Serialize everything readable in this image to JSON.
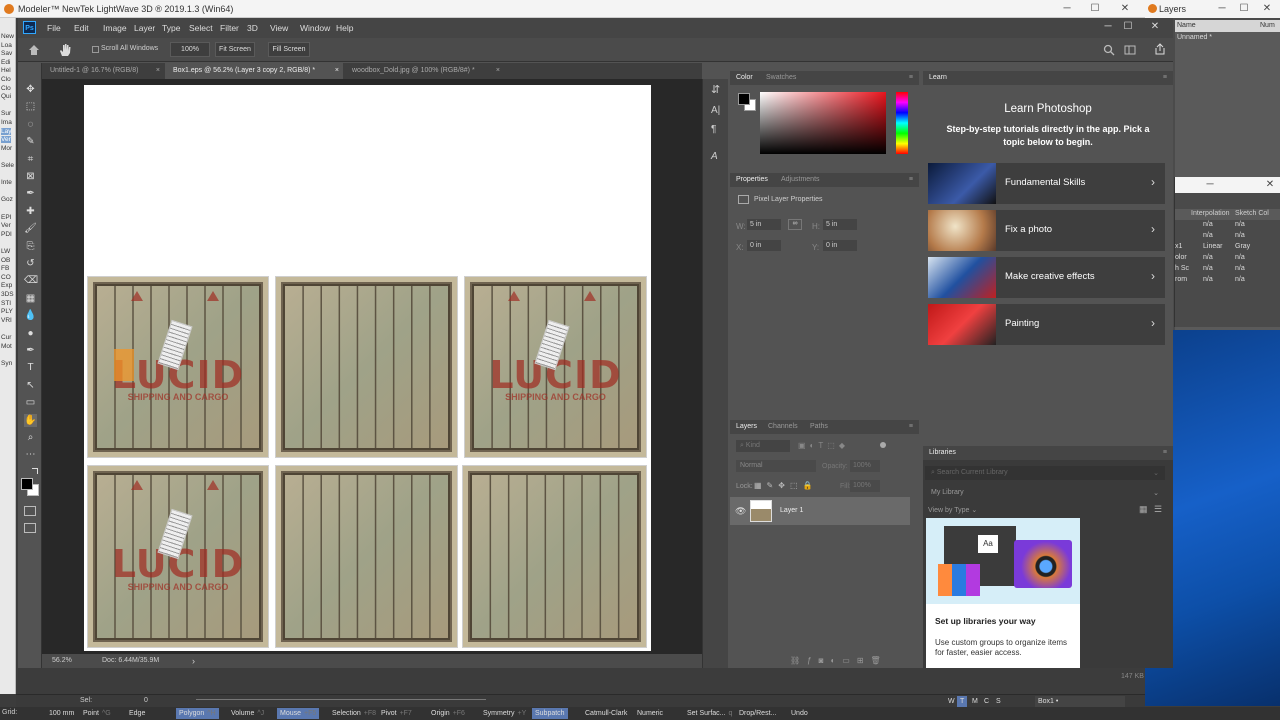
{
  "modeler": {
    "title": "Modeler™ NewTek LightWave 3D ® 2019.1.3 (Win64)",
    "left_items": [
      "New",
      "Loa",
      "Sav",
      "Edi",
      "Hel",
      "Clo",
      "Clo",
      "Qui",
      "",
      "Sur",
      "Ima",
      "Lay",
      "Ver",
      "Mor",
      "",
      "Sele",
      "",
      "Inte",
      "",
      "Goz",
      "",
      "EPI",
      "Ver",
      "PDI",
      "",
      "LW",
      "OB",
      "FB",
      "CO",
      "Exp",
      "3DS",
      "STI",
      "PLY",
      "VRI",
      "",
      "Cur",
      "Mot",
      "",
      "Syn"
    ],
    "bottom1": {
      "sel_label": "Sel:",
      "sel_value": "0"
    },
    "bottom2": [
      {
        "label": "100 mm",
        "act": false
      },
      {
        "label": "Point",
        "key": "^G",
        "act": false
      },
      {
        "label": "Edge",
        "key": "",
        "act": false
      },
      {
        "label": "Polygon",
        "key": "^H",
        "act": true
      },
      {
        "label": "Volume",
        "key": "^J",
        "act": false
      },
      {
        "label": "Mouse",
        "key": "+F5",
        "act": true
      },
      {
        "label": "Selection",
        "key": "+F8",
        "act": false
      },
      {
        "label": "Pivot",
        "key": "+F7",
        "act": false
      },
      {
        "label": "Origin",
        "key": "+F6",
        "act": false
      },
      {
        "label": "Symmetry",
        "key": "+Y",
        "act": false
      },
      {
        "label": "Subpatch",
        "key": "",
        "act": true
      },
      {
        "label": "Catmull-Clark",
        "key": "",
        "act": false
      },
      {
        "label": "Numeric",
        "key": "",
        "act": false
      },
      {
        "label": "Set Surfac...",
        "key": "q",
        "act": false
      },
      {
        "label": "Drop/Rest...",
        "key": "",
        "act": false
      },
      {
        "label": "Undo",
        "key": "",
        "act": false
      }
    ],
    "grid_label": "Grid:",
    "view_buttons": [
      "W",
      "T",
      "M",
      "C",
      "S"
    ],
    "object_name": "Box1"
  },
  "layers_window": {
    "title": "Layers",
    "col_name": "Name",
    "col_num": "Num",
    "row_unnamed": "Unnamed *",
    "table_headers": [
      "Interpolation",
      "Sketch Col"
    ],
    "rows": [
      [
        "n/a",
        "n/a"
      ],
      [
        "n/a",
        "n/a"
      ],
      [
        "Linear",
        "Gray"
      ],
      [
        "n/a",
        "n/a"
      ],
      [
        "n/a",
        "n/a"
      ],
      [
        "n/a",
        "n/a"
      ]
    ],
    "row_prefix": [
      "",
      "",
      "x1",
      "olor",
      "h Sc",
      "rom"
    ]
  },
  "ps": {
    "menu": [
      "File",
      "Edit",
      "Image",
      "Layer",
      "Type",
      "Select",
      "Filter",
      "3D",
      "View",
      "Window",
      "Help"
    ],
    "options": {
      "scroll_all": "Scroll All Windows",
      "zoom": "100%",
      "fit": "Fit Screen",
      "fill": "Fill Screen"
    },
    "tabs": [
      {
        "label": "Untitled-1 @ 16.7% (RGB/8)",
        "act": false
      },
      {
        "label": "Box1.eps @ 56.2% (Layer 3 copy 2, RGB/8) *",
        "act": true
      },
      {
        "label": "woodbox_Dold.jpg @ 100% (RGB/8#) *",
        "act": false
      }
    ],
    "status": {
      "zoom": "56.2%",
      "doc": "Doc: 6.44M/35.9M"
    },
    "color_tabs": [
      "Color",
      "Swatches"
    ],
    "prop_tabs": [
      "Properties",
      "Adjustments"
    ],
    "prop_title": "Pixel Layer Properties",
    "prop_fields": {
      "w_label": "W:",
      "w": "5 in",
      "h_label": "H:",
      "h": "5 in",
      "x_label": "X:",
      "x": "0 in",
      "y_label": "Y:",
      "y": "0 in"
    },
    "layer_tabs": [
      "Layers",
      "Channels",
      "Paths"
    ],
    "layer_kind": "Kind",
    "blend_mode": "Normal",
    "opacity_label": "Opacity:",
    "opacity": "100%",
    "lock_label": "Lock:",
    "fill_label": "Fill:",
    "fill": "100%",
    "layer_name": "Layer 1",
    "learn": {
      "tab": "Learn",
      "title": "Learn Photoshop",
      "subtitle": "Step-by-step tutorials directly in the app. Pick a topic below to begin.",
      "cards": [
        "Fundamental Skills",
        "Fix a photo",
        "Make creative effects",
        "Painting"
      ]
    },
    "libraries": {
      "tab": "Libraries",
      "search_placeholder": "Search Current Library",
      "library": "My Library",
      "view_by": "View by Type",
      "promo_title": "Set up libraries your way",
      "promo_text": "Use custom groups to organize items for faster, easier access.",
      "size": "147 KB"
    }
  },
  "crates": [
    {
      "logo": true,
      "label": "LUCID",
      "sub": "SHIPPING AND CARGO",
      "tag": true
    },
    {
      "logo": false
    },
    {
      "logo": true,
      "label": "LUCID",
      "sub": "SHIPPING AND CARGO",
      "tag": true
    },
    {
      "logo": true,
      "label": "LUCID",
      "sub": "SHIPPING AND CARGO",
      "tag": true
    },
    {
      "logo": false
    },
    {
      "logo": false
    }
  ],
  "colors": {
    "brand_ps": "#31a8ff",
    "active_blue": "#5a78b0",
    "fg_color": "#000000",
    "bg_color": "#ffffff"
  }
}
